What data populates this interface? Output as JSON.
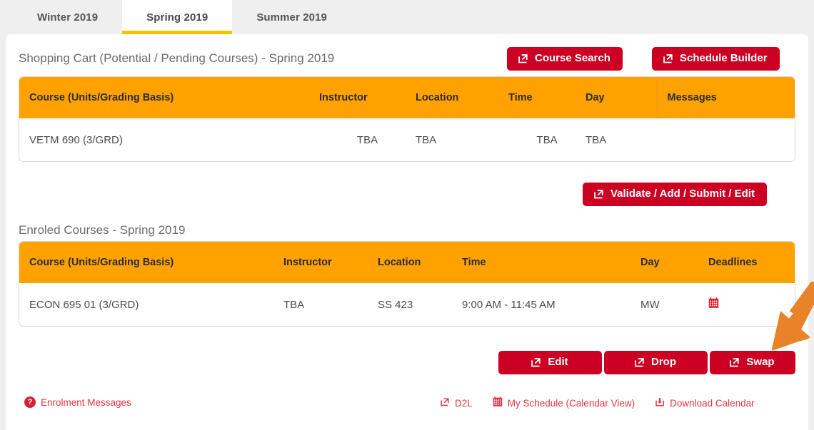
{
  "tabs": [
    {
      "label": "Winter 2019",
      "active": false
    },
    {
      "label": "Spring 2019",
      "active": true
    },
    {
      "label": "Summer 2019",
      "active": false
    }
  ],
  "shopping_cart": {
    "title": "Shopping Cart (Potential / Pending Courses) - Spring 2019",
    "actions": [
      {
        "label": "Course Search",
        "icon": "external-link-icon"
      },
      {
        "label": "Schedule Builder",
        "icon": "external-link-icon"
      }
    ],
    "columns": [
      "Course (Units/Grading Basis)",
      "Instructor",
      "Location",
      "Time",
      "Day",
      "Messages"
    ],
    "rows": [
      {
        "course": "VETM 690 (3/GRD)",
        "instructor": "TBA",
        "location": "TBA",
        "time": "TBA",
        "day": "TBA",
        "messages": ""
      }
    ],
    "submit_button": {
      "label": "Validate / Add / Submit / Edit",
      "icon": "external-link-icon"
    }
  },
  "enroled_courses": {
    "title": "Enroled Courses - Spring 2019",
    "columns": [
      "Course (Units/Grading Basis)",
      "Instructor",
      "Location",
      "Time",
      "Day",
      "Deadlines"
    ],
    "rows": [
      {
        "course": "ECON  695 01 (3/GRD)",
        "instructor": "TBA",
        "location": "SS 423",
        "time": "9:00 AM - 11:45 AM",
        "day": "MW",
        "deadlines_icon": "calendar-icon"
      }
    ],
    "actions": [
      {
        "label": "Edit",
        "icon": "external-link-icon"
      },
      {
        "label": "Drop",
        "icon": "external-link-icon"
      },
      {
        "label": "Swap",
        "icon": "external-link-icon"
      }
    ]
  },
  "footer": {
    "enrolment_messages": {
      "label": "Enrolment Messages",
      "icon": "question-mark-icon"
    },
    "links": [
      {
        "label": "D2L",
        "icon": "external-link-icon"
      },
      {
        "label": "My Schedule (Calendar View)",
        "icon": "calendar-icon"
      },
      {
        "label": "Download Calendar",
        "icon": "download-icon"
      }
    ]
  },
  "annotation": {
    "arrow": "orange-arrow-pointing-to-swap-button"
  },
  "colors": {
    "accent_orange": "#ffa200",
    "tab_underline": "#f5c400",
    "button_red": "#cc0022",
    "link_red": "#e8343f",
    "page_bg": "#efefef",
    "annotation_orange": "#e8832a"
  }
}
